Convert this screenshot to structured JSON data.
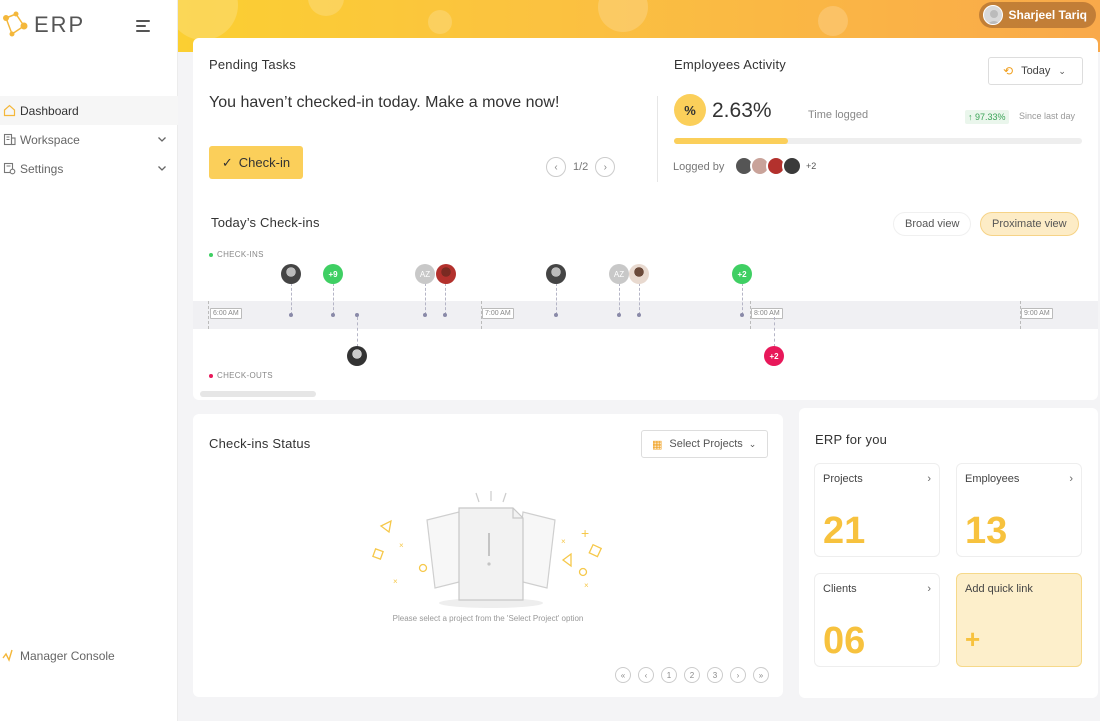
{
  "app": {
    "logo_text": "ERP"
  },
  "user": {
    "name": "Sharjeel Tariq"
  },
  "sidebar": {
    "items": [
      {
        "label": "Dashboard",
        "icon": "home-icon"
      },
      {
        "label": "Workspace",
        "icon": "building-icon"
      },
      {
        "label": "Settings",
        "icon": "settings-icon"
      }
    ],
    "footer_label": "Manager Console"
  },
  "pending": {
    "title": "Pending Tasks",
    "message": "You haven’t checked-in today. Make a move now!",
    "checkin_label": "Check-in",
    "pager": "1/2"
  },
  "activity": {
    "title": "Employees Activity",
    "range_label": "Today",
    "percent_label": "2.63%",
    "percent_value": 2.63,
    "time_logged_label": "Time logged",
    "trend": "97.33%",
    "since_label": "Since last day",
    "progress_fraction": 0.28,
    "logged_by_label": "Logged by",
    "more_count": "+2"
  },
  "checkins": {
    "title": "Today’s Check-ins",
    "broad_label": "Broad view",
    "proximate_label": "Proximate view",
    "checkins_lane": "CHECK-INS",
    "checkouts_lane": "CHECK-OUTS",
    "ticks": [
      "6:00 AM",
      "7:00 AM",
      "8:00 AM",
      "9:00 AM"
    ],
    "badges": {
      "plus9": "+9",
      "plus2_in": "+2",
      "plus2_out": "+2",
      "az1": "AZ",
      "az2": "AZ"
    }
  },
  "status": {
    "title": "Check-ins Status",
    "select_label": "Select Projects",
    "empty_message": "Please select a project from the 'Select Project' option",
    "pages": [
      "1",
      "2",
      "3"
    ]
  },
  "erp": {
    "title": "ERP for you",
    "projects_label": "Projects",
    "projects_count": "21",
    "employees_label": "Employees",
    "employees_count": "13",
    "clients_label": "Clients",
    "clients_count": "06",
    "quick_label": "Add quick link",
    "quick_plus": "+"
  },
  "colors": {
    "accent": "#fbcf5a",
    "green": "#3fcf63",
    "pink": "#e8185a"
  }
}
